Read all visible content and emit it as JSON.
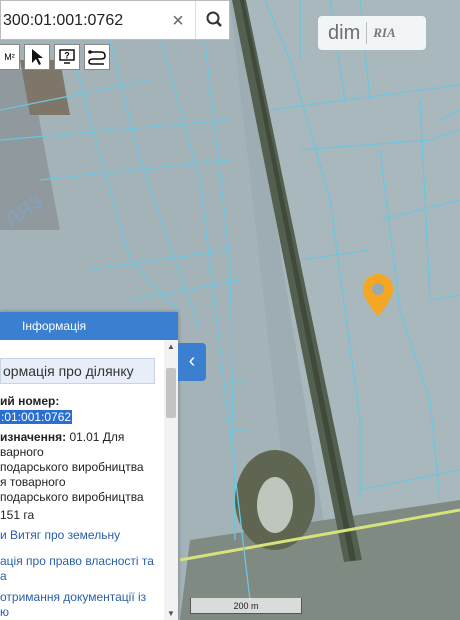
{
  "search": {
    "value": "300:01:001:0762",
    "clear_glyph": "×"
  },
  "toolbar": {
    "area_tool_label": "M²"
  },
  "logo": {
    "part1": "dim",
    "part2": "RIA"
  },
  "panel": {
    "header": "Інформація",
    "subtitle": "ормація про ділянку",
    "cadastre_label": "ий номер:",
    "cadastre_value": ":01:001:0762",
    "purpose_label": "изначення:",
    "purpose_line1": " 01.01 Для",
    "purpose_line2": "варного",
    "purpose_line3": "подарського виробництва",
    "purpose_line4": "я товарного",
    "purpose_line5": "подарського виробництва",
    "area": "151 га",
    "link_extract": "и Витяг про земельну",
    "link_rights_1": "ація про право власності та",
    "link_rights_2": "а",
    "link_docs_1": "отримання документації із",
    "link_docs_2": "ю",
    "toggle_glyph": "‹"
  },
  "map": {
    "scale_label": "200 m",
    "watermark": "ЛЯЗ",
    "colors": {
      "parcel_line": "#6cc6e0",
      "marker": "#f5a623",
      "panel_header": "#3a7fd0",
      "road": "#d8e27a"
    }
  }
}
